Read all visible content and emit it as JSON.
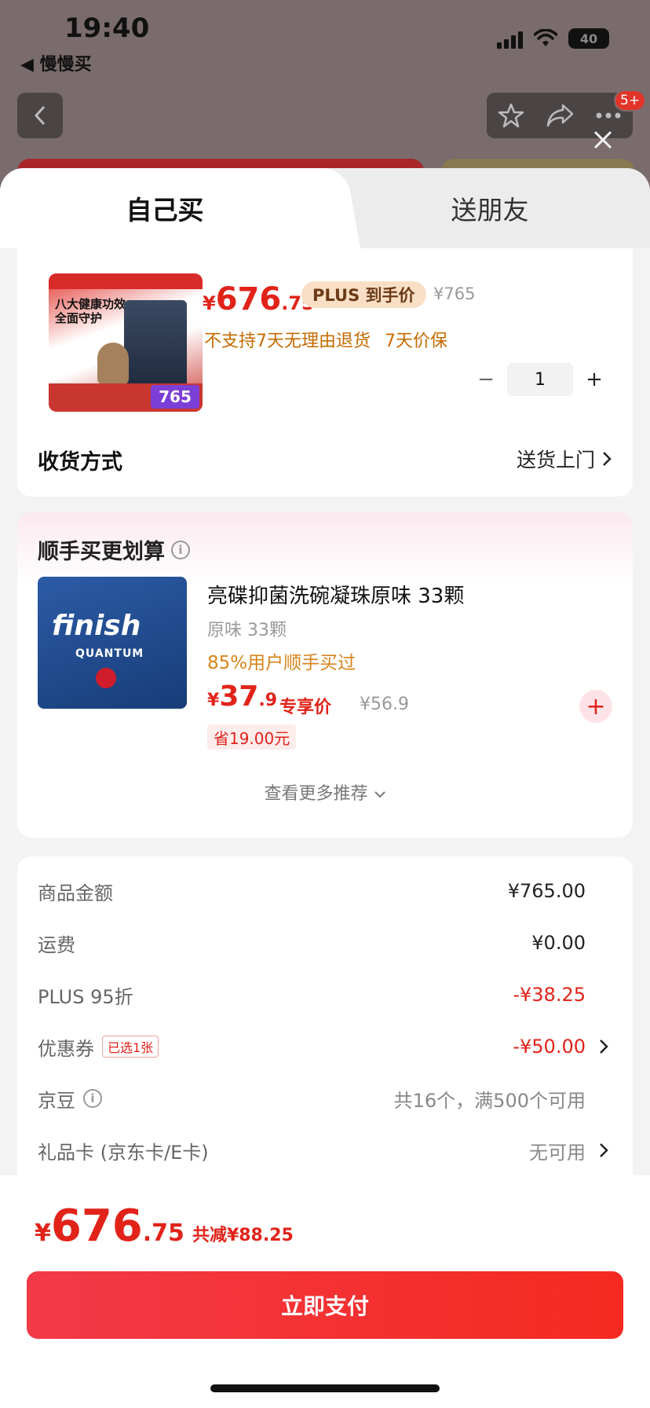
{
  "status_bar": {
    "time": "19:40",
    "back_app": "◀ 慢慢买",
    "battery": "40"
  },
  "nav": {
    "badge": "5+"
  },
  "tabs": [
    {
      "label": "自己买",
      "active": true
    },
    {
      "label": "送朋友",
      "active": false
    }
  ],
  "product": {
    "thumb_title": "八大健康功效 全面守护",
    "thumb_price": "765",
    "price_currency": "¥",
    "price_int": "676",
    "price_dec": ".75",
    "plus_tag": "PLUS 到手价",
    "original_price": "¥765",
    "policy": [
      "不支持7天无理由退货",
      "7天价保"
    ],
    "quantity": "1",
    "delivery_label": "收货方式",
    "delivery_value": "送货上门"
  },
  "recommend": {
    "title": "顺手买更划算",
    "item": {
      "name": "亮碟抑菌洗碗凝珠原味 33颗",
      "spec": "原味 33颗",
      "social": "85%用户顺手买过",
      "price_currency": "¥",
      "price_int": "37",
      "price_dec": ".9",
      "member_label": "专享价",
      "original_price": "¥56.9",
      "save": "省19.00元",
      "brand": "finish",
      "sub_brand": "QUANTUM"
    },
    "more": "查看更多推荐"
  },
  "summary": {
    "rows": [
      {
        "label": "商品金额",
        "value": "¥765.00"
      },
      {
        "label": "运费",
        "value": "¥0.00"
      },
      {
        "label": "PLUS 95折",
        "value": "-¥38.25"
      },
      {
        "label": "优惠券",
        "tag": "已选1张",
        "value": "-¥50.00"
      },
      {
        "label": "京豆",
        "value": "共16个，满500个可用"
      },
      {
        "label": "礼品卡 (京东卡/E卡)",
        "value": "无可用"
      }
    ]
  },
  "footer": {
    "currency": "¥",
    "total_int": "676",
    "total_dec": ".75",
    "saved": "共减¥88.25",
    "pay_button": "立即支付"
  },
  "colors": {
    "accent": "#e2231a",
    "orange": "#c56a00",
    "plus_bg": "#f9dfc6"
  }
}
